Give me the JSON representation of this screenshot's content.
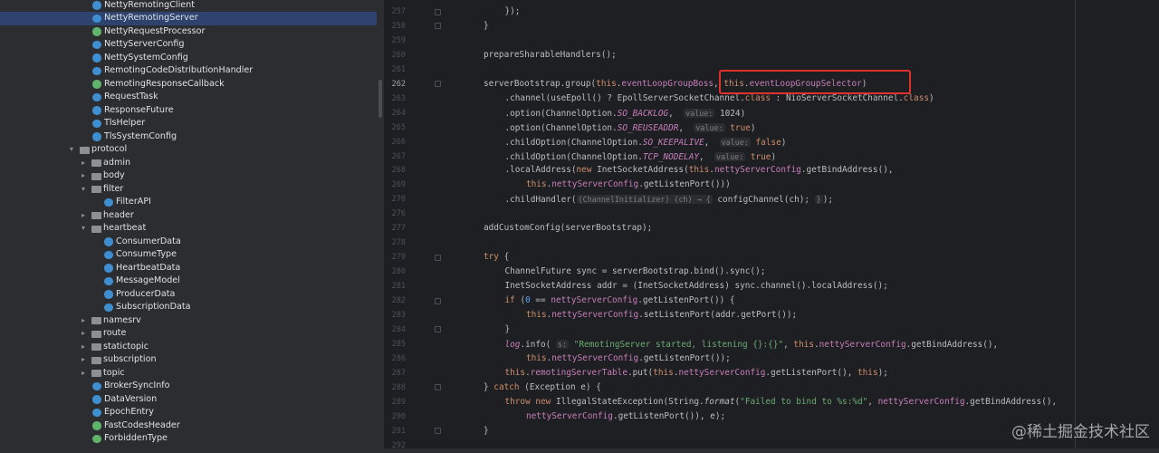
{
  "project_tree": {
    "items": [
      {
        "label": "NettyRemotingClient",
        "type": "class",
        "indent": 1,
        "selected": false
      },
      {
        "label": "NettyRemotingServer",
        "type": "class",
        "indent": 1,
        "selected": true
      },
      {
        "label": "NettyRequestProcessor",
        "type": "iface",
        "indent": 1,
        "selected": false
      },
      {
        "label": "NettyServerConfig",
        "type": "class",
        "indent": 1,
        "selected": false
      },
      {
        "label": "NettySystemConfig",
        "type": "class",
        "indent": 1,
        "selected": false
      },
      {
        "label": "RemotingCodeDistributionHandler",
        "type": "class",
        "indent": 1,
        "selected": false
      },
      {
        "label": "RemotingResponseCallback",
        "type": "iface",
        "indent": 1,
        "selected": false
      },
      {
        "label": "RequestTask",
        "type": "class",
        "indent": 1,
        "selected": false
      },
      {
        "label": "ResponseFuture",
        "type": "class",
        "indent": 1,
        "selected": false
      },
      {
        "label": "TlsHelper",
        "type": "class",
        "indent": 1,
        "selected": false
      },
      {
        "label": "TlsSystemConfig",
        "type": "class",
        "indent": 1,
        "selected": false
      },
      {
        "label": "protocol",
        "type": "folder",
        "indent": 0,
        "expanded": true
      },
      {
        "label": "admin",
        "type": "folder",
        "indent": 1,
        "expanded": false
      },
      {
        "label": "body",
        "type": "folder",
        "indent": 1,
        "expanded": false
      },
      {
        "label": "filter",
        "type": "folder",
        "indent": 1,
        "expanded": true
      },
      {
        "label": "FilterAPI",
        "type": "class",
        "indent": 2,
        "selected": false
      },
      {
        "label": "header",
        "type": "folder",
        "indent": 1,
        "expanded": false
      },
      {
        "label": "heartbeat",
        "type": "folder",
        "indent": 1,
        "expanded": true
      },
      {
        "label": "ConsumerData",
        "type": "class",
        "indent": 2,
        "selected": false
      },
      {
        "label": "ConsumeType",
        "type": "class",
        "indent": 2,
        "selected": false
      },
      {
        "label": "HeartbeatData",
        "type": "class",
        "indent": 2,
        "selected": false
      },
      {
        "label": "MessageModel",
        "type": "class",
        "indent": 2,
        "selected": false
      },
      {
        "label": "ProducerData",
        "type": "class",
        "indent": 2,
        "selected": false
      },
      {
        "label": "SubscriptionData",
        "type": "class",
        "indent": 2,
        "selected": false
      },
      {
        "label": "namesrv",
        "type": "folder",
        "indent": 1,
        "expanded": false
      },
      {
        "label": "route",
        "type": "folder",
        "indent": 1,
        "expanded": false
      },
      {
        "label": "statictopic",
        "type": "folder",
        "indent": 1,
        "expanded": false
      },
      {
        "label": "subscription",
        "type": "folder",
        "indent": 1,
        "expanded": false
      },
      {
        "label": "topic",
        "type": "folder",
        "indent": 1,
        "expanded": false
      },
      {
        "label": "BrokerSyncInfo",
        "type": "class",
        "indent": 1,
        "selected": false
      },
      {
        "label": "DataVersion",
        "type": "class",
        "indent": 1,
        "selected": false
      },
      {
        "label": "EpochEntry",
        "type": "class",
        "indent": 1,
        "selected": false
      },
      {
        "label": "FastCodesHeader",
        "type": "iface",
        "indent": 1,
        "selected": false
      },
      {
        "label": "ForbiddenType",
        "type": "iface",
        "indent": 1,
        "selected": false
      }
    ]
  },
  "editor": {
    "active_line": 262,
    "lines": [
      {
        "n": 257,
        "html": "});",
        "indent": 2,
        "fold": true
      },
      {
        "n": 258,
        "html": "}",
        "indent": 1,
        "fold": true
      },
      {
        "n": 259,
        "html": "",
        "indent": 0
      },
      {
        "n": 260,
        "html": "prepareSharableHandlers();",
        "indent": 1
      },
      {
        "n": 261,
        "html": "",
        "indent": 0
      },
      {
        "n": 262,
        "html": "serverBootstrap.group(<span class='kw'>this</span>.<span class='fld'>eventLoopGroupBoss</span>, <span class='kw'>this</span>.<span class='fld'>eventLoopGroupSelector</span>)",
        "indent": 1,
        "fold": true
      },
      {
        "n": 263,
        "html": ".channel(useEpoll() ? EpollServerSocketChannel.<span class='kw'>class</span> : NioServerSocketChannel.<span class='kw'>class</span>)",
        "indent": 2
      },
      {
        "n": 264,
        "html": ".option(ChannelOption.<span class='it'>SO_BACKLOG</span>,  <span class='hint'>value:</span> 1024)",
        "indent": 2
      },
      {
        "n": 265,
        "html": ".option(ChannelOption.<span class='it'>SO_REUSEADDR</span>,  <span class='hint'>value:</span> <span class='kw'>true</span>)",
        "indent": 2
      },
      {
        "n": 266,
        "html": ".childOption(ChannelOption.<span class='it'>SO_KEEPALIVE</span>,  <span class='hint'>value:</span> <span class='kw'>false</span>)",
        "indent": 2
      },
      {
        "n": 267,
        "html": ".childOption(ChannelOption.<span class='it'>TCP_NODELAY</span>,  <span class='hint'>value:</span> <span class='kw'>true</span>)",
        "indent": 2
      },
      {
        "n": 268,
        "html": ".localAddress(<span class='kw'>new</span> InetSocketAddress(<span class='kw'>this</span>.<span class='fld'>nettyServerConfig</span>.getBindAddress(),",
        "indent": 2
      },
      {
        "n": 269,
        "html": "<span class='kw'>this</span>.<span class='fld'>nettyServerConfig</span>.getListenPort()))",
        "indent": 3
      },
      {
        "n": 270,
        "html": ".childHandler(<span class='hint'>(ChannelInitializer) (ch) → {</span> configChannel(ch); <span class='hint'>}</span>);",
        "indent": 2
      },
      {
        "n": 276,
        "html": "",
        "indent": 0
      },
      {
        "n": 277,
        "html": "addCustomConfig(serverBootstrap);",
        "indent": 1
      },
      {
        "n": 278,
        "html": "",
        "indent": 0
      },
      {
        "n": 279,
        "html": "<span class='kw'>try</span> {",
        "indent": 1,
        "fold": true
      },
      {
        "n": 280,
        "html": "ChannelFuture sync = serverBootstrap.bind().sync();",
        "indent": 2
      },
      {
        "n": 281,
        "html": "InetSocketAddress addr = (InetSocketAddress) sync.channel().localAddress();",
        "indent": 2
      },
      {
        "n": 282,
        "html": "<span class='kw'>if</span> (<span class='fn'>0</span> == <span class='fld'>nettyServerConfig</span>.getListenPort()) {",
        "indent": 2,
        "fold": true
      },
      {
        "n": 283,
        "html": "<span class='kw'>this</span>.<span class='fld'>nettyServerConfig</span>.setListenPort(addr.getPort());",
        "indent": 3
      },
      {
        "n": 284,
        "html": "}",
        "indent": 2,
        "fold": true
      },
      {
        "n": 285,
        "html": "<span class='log'>log</span>.info( <span class='hint'>s:</span> <span class='str'>\"RemotingServer started, listening {}:{}\"</span>, <span class='kw'>this</span>.<span class='fld'>nettyServerConfig</span>.getBindAddress(),",
        "indent": 2
      },
      {
        "n": 286,
        "html": "<span class='kw'>this</span>.<span class='fld'>nettyServerConfig</span>.getListenPort());",
        "indent": 3
      },
      {
        "n": 287,
        "html": "<span class='kw'>this</span>.<span class='fld'>remotingServerTable</span>.put(<span class='kw'>this</span>.<span class='fld'>nettyServerConfig</span>.getListenPort(), <span class='kw'>this</span>);",
        "indent": 2
      },
      {
        "n": 288,
        "html": "} <span class='kw'>catch</span> (Exception e) {",
        "indent": 1,
        "fold": true
      },
      {
        "n": 289,
        "html": "<span class='kw'>throw new</span> IllegalStateException(String.<span class='ital'>format</span>(<span class='str'>\"Failed to bind to %s:%d\"</span>, <span class='fld'>nettyServerConfig</span>.getBindAddress(),",
        "indent": 2
      },
      {
        "n": 290,
        "html": "<span class='fld'>nettyServerConfig</span>.getListenPort()), e);",
        "indent": 3
      },
      {
        "n": 291,
        "html": "}",
        "indent": 1,
        "fold": true
      },
      {
        "n": 292,
        "html": "",
        "indent": 0
      }
    ]
  },
  "watermark": "@稀土掘金技术社区"
}
